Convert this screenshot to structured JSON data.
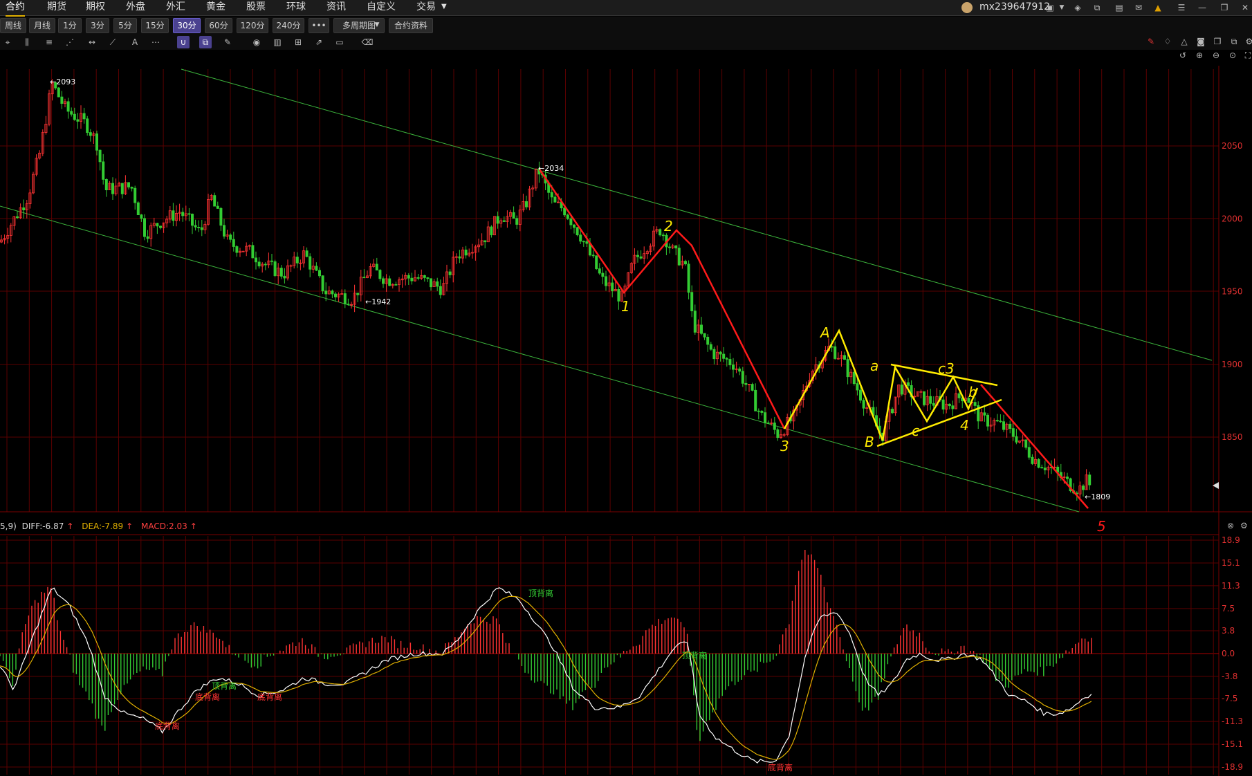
{
  "menubar": {
    "items": [
      "合约",
      "期货",
      "期权",
      "外盘",
      "外汇",
      "黄金",
      "股票",
      "环球",
      "资讯",
      "自定义",
      "交易"
    ],
    "active": 0,
    "dropdown_item": 10
  },
  "user": {
    "name": "mx239647912"
  },
  "toolbar": {
    "periods": [
      "周线",
      "月线",
      "1分",
      "3分",
      "5分",
      "15分",
      "30分",
      "60分",
      "120分",
      "240分",
      "•••",
      "多周期图",
      "合约资料"
    ],
    "active_period": 6
  },
  "colors": {
    "up": "#ff3333",
    "down": "#33cc33",
    "grid": "#5a0000",
    "axis_text": "#e03030",
    "channel": "#3cb43c",
    "wave_red": "#ff1a1a",
    "wave_yellow": "#ffeb00",
    "diff_line": "#ffffff",
    "dea_line": "#e0b000"
  },
  "price_axis": {
    "ticks": [
      "2050",
      "2000",
      "1950",
      "1900",
      "1850"
    ]
  },
  "price_annotations": [
    "2093",
    "2034",
    "1942",
    "1809"
  ],
  "macd": {
    "prefix": "5,9)",
    "diff_label": "DIFF:-6.87",
    "dea_label": "DEA:-7.89",
    "macd_label": "MACD:2.03",
    "arrow": "↑",
    "axis_ticks": [
      "18.9",
      "15.1",
      "11.3",
      "7.5",
      "3.8",
      "0.0",
      "-3.8",
      "-7.5",
      "-11.3",
      "-15.1",
      "-18.9"
    ],
    "annotations": [
      {
        "text": "顶背离",
        "color": "#33cc33"
      },
      {
        "text": "底背离",
        "color": "#ff3333"
      },
      {
        "text": "底背离",
        "color": "#ff3333"
      },
      {
        "text": "底背离",
        "color": "#ff3333"
      },
      {
        "text": "顶背离",
        "color": "#33cc33"
      },
      {
        "text": "顶背离",
        "color": "#33cc33"
      },
      {
        "text": "底背离",
        "color": "#ff3333"
      }
    ]
  },
  "wave_labels": [
    "1",
    "2",
    "3",
    "A",
    "B",
    "a",
    "c",
    "c3",
    "b",
    "4",
    "5"
  ]
}
